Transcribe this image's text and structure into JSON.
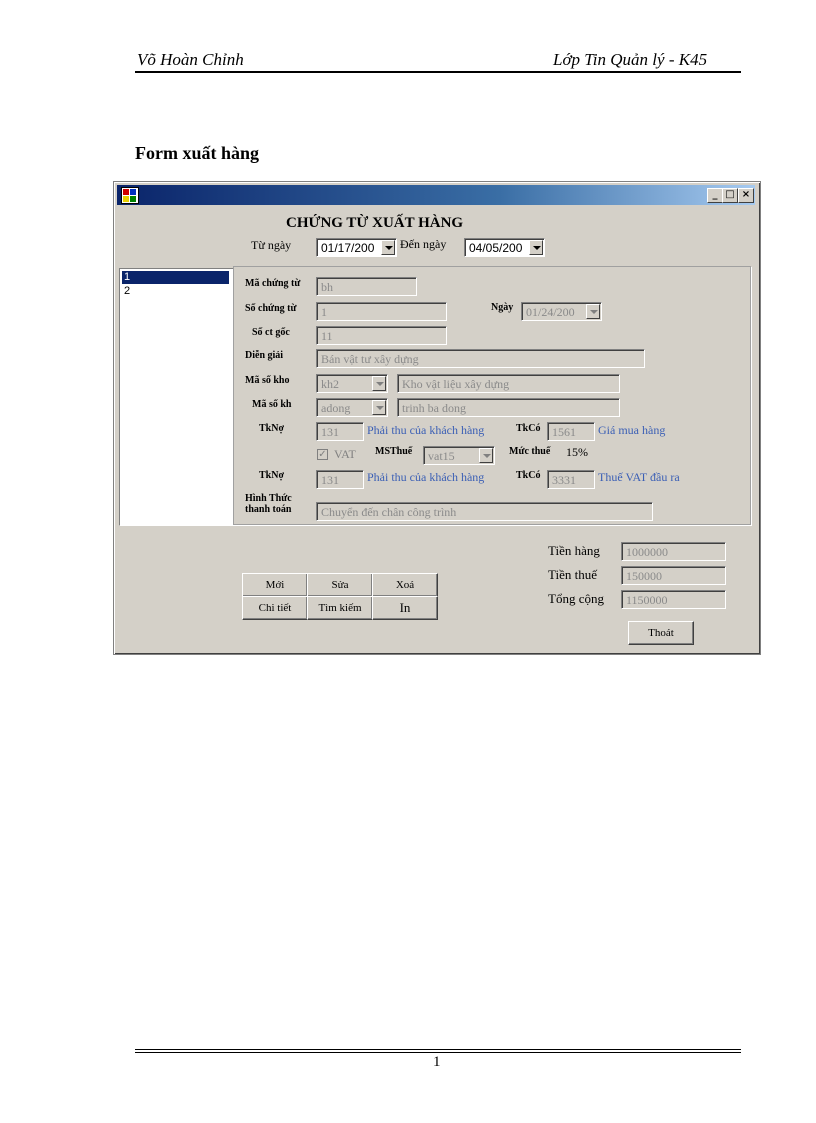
{
  "page_header": {
    "left": "Võ Hoàn Chỉnh",
    "right": "Lớp Tin Quản lý - K45"
  },
  "section_title": "Form xuất hàng",
  "window": {
    "buttons": {
      "minimize": "_",
      "maximize": "□",
      "close": "×"
    },
    "heading": "CHỨNG TỪ XUẤT HÀNG",
    "from_date_label": "Từ ngày",
    "from_date_value": "01/17/200",
    "to_date_label": "Đến ngày",
    "to_date_value": "04/05/200",
    "list_items": [
      "1",
      "2"
    ],
    "form": {
      "ma_chung_tu_label": "Mã chứng từ",
      "ma_chung_tu_value": "bh",
      "so_chung_tu_label": "Số chứng từ",
      "so_chung_tu_value": "1",
      "ngay_label": "Ngày",
      "ngay_value": "01/24/200",
      "so_ct_goc_label": "Số ct gốc",
      "so_ct_goc_value": "11",
      "dien_giai_label": "Diễn giải",
      "dien_giai_value": "Bán vật tư xây dựng",
      "ma_so_kho_label": "Mã số kho",
      "ma_so_kho_value": "kh2",
      "ten_kho_value": "Kho vật liệu xây dựng",
      "ma_so_kh_label": "Mã số kh",
      "ma_so_kh_value": "adong",
      "ten_kh_value": "trinh ba dong",
      "tkno1_label": "TkNợ",
      "tkno1_value": "131",
      "tkno1_desc": "Phải thu của khách hàng",
      "tkco1_label": "TkCó",
      "tkco1_value": "1561",
      "tkco1_desc": "Giá mua hàng",
      "vat_label": "VAT",
      "msthue_label": "MSThuế",
      "msthue_value": "vat15",
      "muc_thue_label": "Mức thuế",
      "muc_thue_value": "15%",
      "tkno2_label": "TkNợ",
      "tkno2_value": "131",
      "tkno2_desc": "Phải thu của khách hàng",
      "tkco2_label": "TkCó",
      "tkco2_value": "3331",
      "tkco2_desc": "Thuế VAT đầu ra",
      "hinh_thuc_label_1": "Hình Thức",
      "hinh_thuc_label_2": "thanh toán",
      "hinh_thuc_value": "Chuyển đến chân công trình"
    },
    "actions": {
      "moi": "Mới",
      "sua": "Sửa",
      "xoa": "Xoá",
      "chi_tiet": "Chi tiết",
      "tim_kiem": "Tìm kiếm",
      "in": "In"
    },
    "totals": {
      "tien_hang_label": "Tiền hàng",
      "tien_hang_value": "1000000",
      "tien_thue_label": "Tiền thuế",
      "tien_thue_value": "150000",
      "tong_cong_label": "Tổng cộng",
      "tong_cong_value": "1150000"
    },
    "exit_button": "Thoát"
  },
  "page_number": "1"
}
